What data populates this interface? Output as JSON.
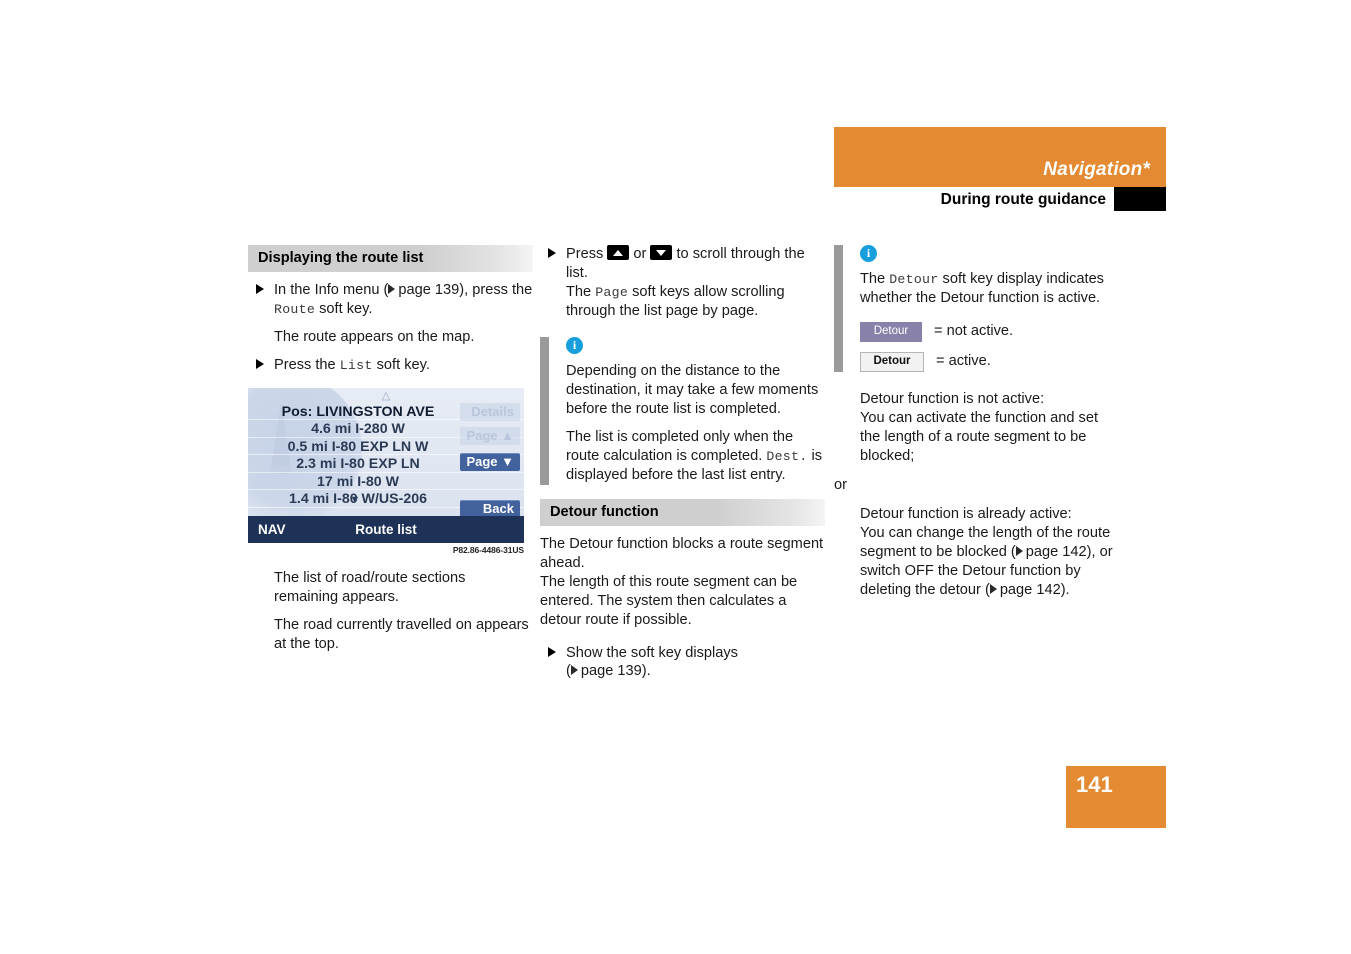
{
  "header": {
    "title": "Navigation*",
    "subtitle": "During route guidance",
    "orange_color": "#e38a33"
  },
  "page_number": "141",
  "columns": {
    "left": {
      "heading": "Displaying the route list",
      "step_1_pre": "In the Info menu (",
      "step_1_ref": "page 139",
      "step_1_mid": "), press the ",
      "step_1_key": "Route",
      "step_1_post": " soft key.",
      "result_1": "The route appears on the map.",
      "step_2_pre": "Press the ",
      "step_2_key": "List",
      "step_2_post": " soft key.",
      "figure": {
        "caret_up": "△",
        "caret_down": "▼",
        "rows": [
          {
            "text": "Pos: LIVINGSTON AVE",
            "header": true
          },
          {
            "text": "4.6 mi I-280 W",
            "header": false
          },
          {
            "text": "0.5 mi I-80 EXP LN W",
            "header": false
          },
          {
            "text": "2.3 mi I-80 EXP LN",
            "header": false
          },
          {
            "text": "17 mi I-80 W",
            "header": false
          },
          {
            "text": "1.4 mi I-80 W/US-206",
            "header": false
          }
        ],
        "softkeys": [
          {
            "label": "Details",
            "state": "dim"
          },
          {
            "label": "Page ▲",
            "state": "dim"
          },
          {
            "label": "Page ▼",
            "state": "on"
          },
          {
            "label": "Back",
            "state": "on"
          }
        ],
        "footer_left": "NAV",
        "footer_title": "Route list",
        "caption": "P82.86-4486-31US"
      },
      "result_2": "The list of road/route sections remaining appears.",
      "result_3": "The road currently travelled on appears at the top."
    },
    "middle": {
      "step_1_pre": "Press ",
      "step_1_mid": " or ",
      "step_1_post": " to scroll through the list.",
      "step_1_line2_pre": "The ",
      "step_1_line2_key": "Page",
      "step_1_line2_post": " soft keys allow scrolling through the list page by page.",
      "note_icon": "i",
      "note_text_1": "Depending on the distance to the destination, it may take a few moments before the route list is completed.",
      "note_text_2_pre": "The list is completed only when the route calculation is completed. ",
      "note_text_2_key": "Dest.",
      "note_text_2_post": " is displayed before the last list entry.",
      "heading": "Detour function",
      "body_1": "The Detour function blocks a route segment ahead.",
      "body_2": "The length of this route segment can be entered. The system then calculates a detour route if possible.",
      "step_2_line1": "Show the soft key displays",
      "step_2_ref": "page 139",
      "step_2_close": ")."
    },
    "right": {
      "note_icon": "i",
      "note_text_pre": "The ",
      "note_text_key": "Detour",
      "note_text_post": " soft key display indicates whether the Detour function is active.",
      "badge_inactive_label": "Detour",
      "badge_inactive_text": "= not active.",
      "badge_inactive_color": "#8882ab",
      "badge_active_label": "Detour",
      "badge_active_text": "= active.",
      "badge_active_color": "#f2f2f2",
      "case_1_line1": "Detour function is not active:",
      "case_1_line2": "You can activate the function and set the length of a route segment to be blocked;",
      "or_word": "or",
      "case_2_line1": "Detour function is already active:",
      "case_2_line2_pre": "You can change the length of the route segment to be blocked (",
      "case_2_ref_1": "page 142",
      "case_2_line2_mid": "), or switch OFF the Detour function by deleting the detour (",
      "case_2_ref_2": "page 142",
      "case_2_line2_post": ")."
    }
  }
}
